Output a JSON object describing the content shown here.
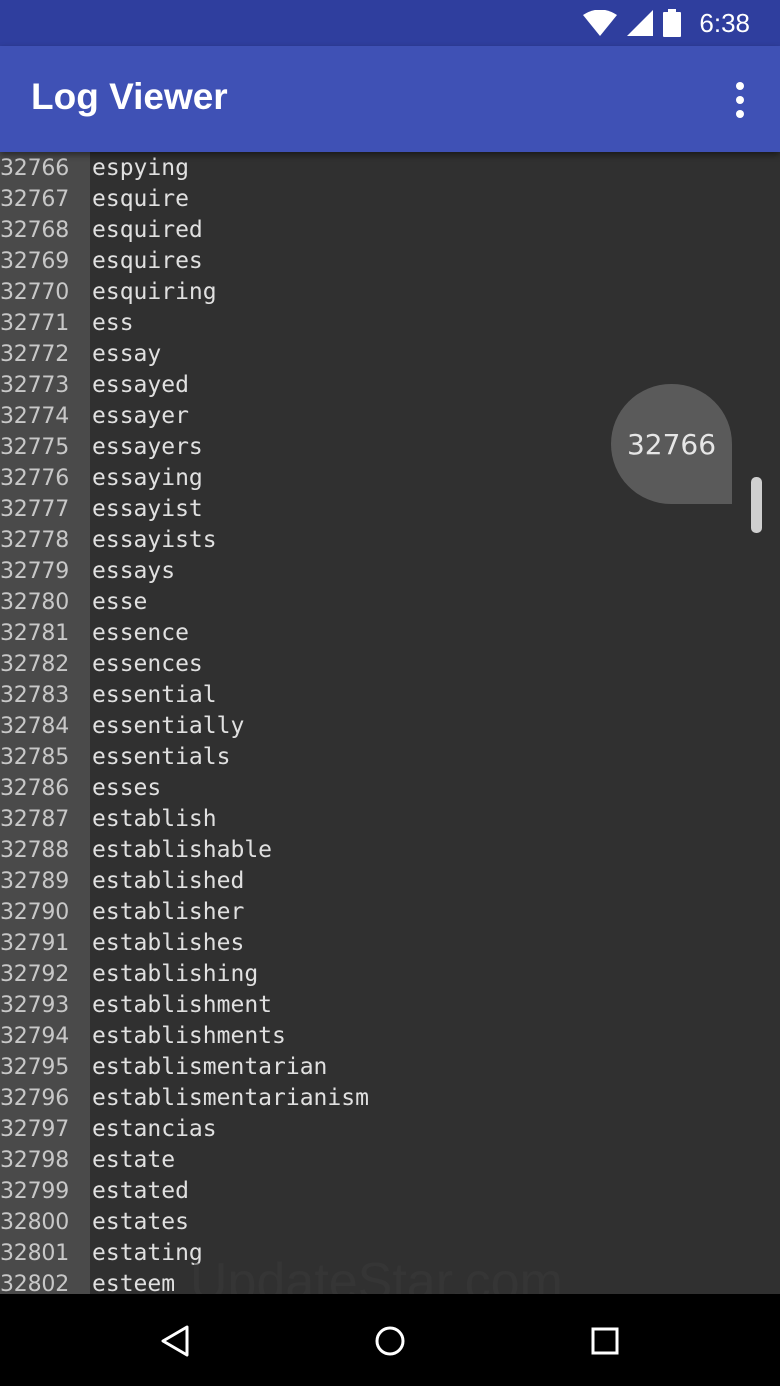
{
  "status_bar": {
    "time": "6:38",
    "icons": [
      "wifi-icon",
      "signal-icon",
      "battery-icon"
    ]
  },
  "app_bar": {
    "title": "Log Viewer",
    "menu_icon": "more-vert-icon"
  },
  "fast_scroll": {
    "bubble_label": "32766"
  },
  "watermark": "UpdateStar.com",
  "log_lines": [
    {
      "num": "32766",
      "text": "espying"
    },
    {
      "num": "32767",
      "text": "esquire"
    },
    {
      "num": "32768",
      "text": "esquired"
    },
    {
      "num": "32769",
      "text": "esquires"
    },
    {
      "num": "32770",
      "text": "esquiring"
    },
    {
      "num": "32771",
      "text": "ess"
    },
    {
      "num": "32772",
      "text": "essay"
    },
    {
      "num": "32773",
      "text": "essayed"
    },
    {
      "num": "32774",
      "text": "essayer"
    },
    {
      "num": "32775",
      "text": "essayers"
    },
    {
      "num": "32776",
      "text": "essaying"
    },
    {
      "num": "32777",
      "text": "essayist"
    },
    {
      "num": "32778",
      "text": "essayists"
    },
    {
      "num": "32779",
      "text": "essays"
    },
    {
      "num": "32780",
      "text": "esse"
    },
    {
      "num": "32781",
      "text": "essence"
    },
    {
      "num": "32782",
      "text": "essences"
    },
    {
      "num": "32783",
      "text": "essential"
    },
    {
      "num": "32784",
      "text": "essentially"
    },
    {
      "num": "32785",
      "text": "essentials"
    },
    {
      "num": "32786",
      "text": "esses"
    },
    {
      "num": "32787",
      "text": "establish"
    },
    {
      "num": "32788",
      "text": "establishable"
    },
    {
      "num": "32789",
      "text": "established"
    },
    {
      "num": "32790",
      "text": "establisher"
    },
    {
      "num": "32791",
      "text": "establishes"
    },
    {
      "num": "32792",
      "text": "establishing"
    },
    {
      "num": "32793",
      "text": "establishment"
    },
    {
      "num": "32794",
      "text": "establishments"
    },
    {
      "num": "32795",
      "text": "establismentarian"
    },
    {
      "num": "32796",
      "text": "establismentarianism"
    },
    {
      "num": "32797",
      "text": "estancias"
    },
    {
      "num": "32798",
      "text": "estate"
    },
    {
      "num": "32799",
      "text": "estated"
    },
    {
      "num": "32800",
      "text": "estates"
    },
    {
      "num": "32801",
      "text": "estating"
    },
    {
      "num": "32802",
      "text": "esteem"
    }
  ],
  "nav_bar": {
    "back_icon": "back-icon",
    "home_icon": "home-icon",
    "recents_icon": "recents-icon"
  }
}
